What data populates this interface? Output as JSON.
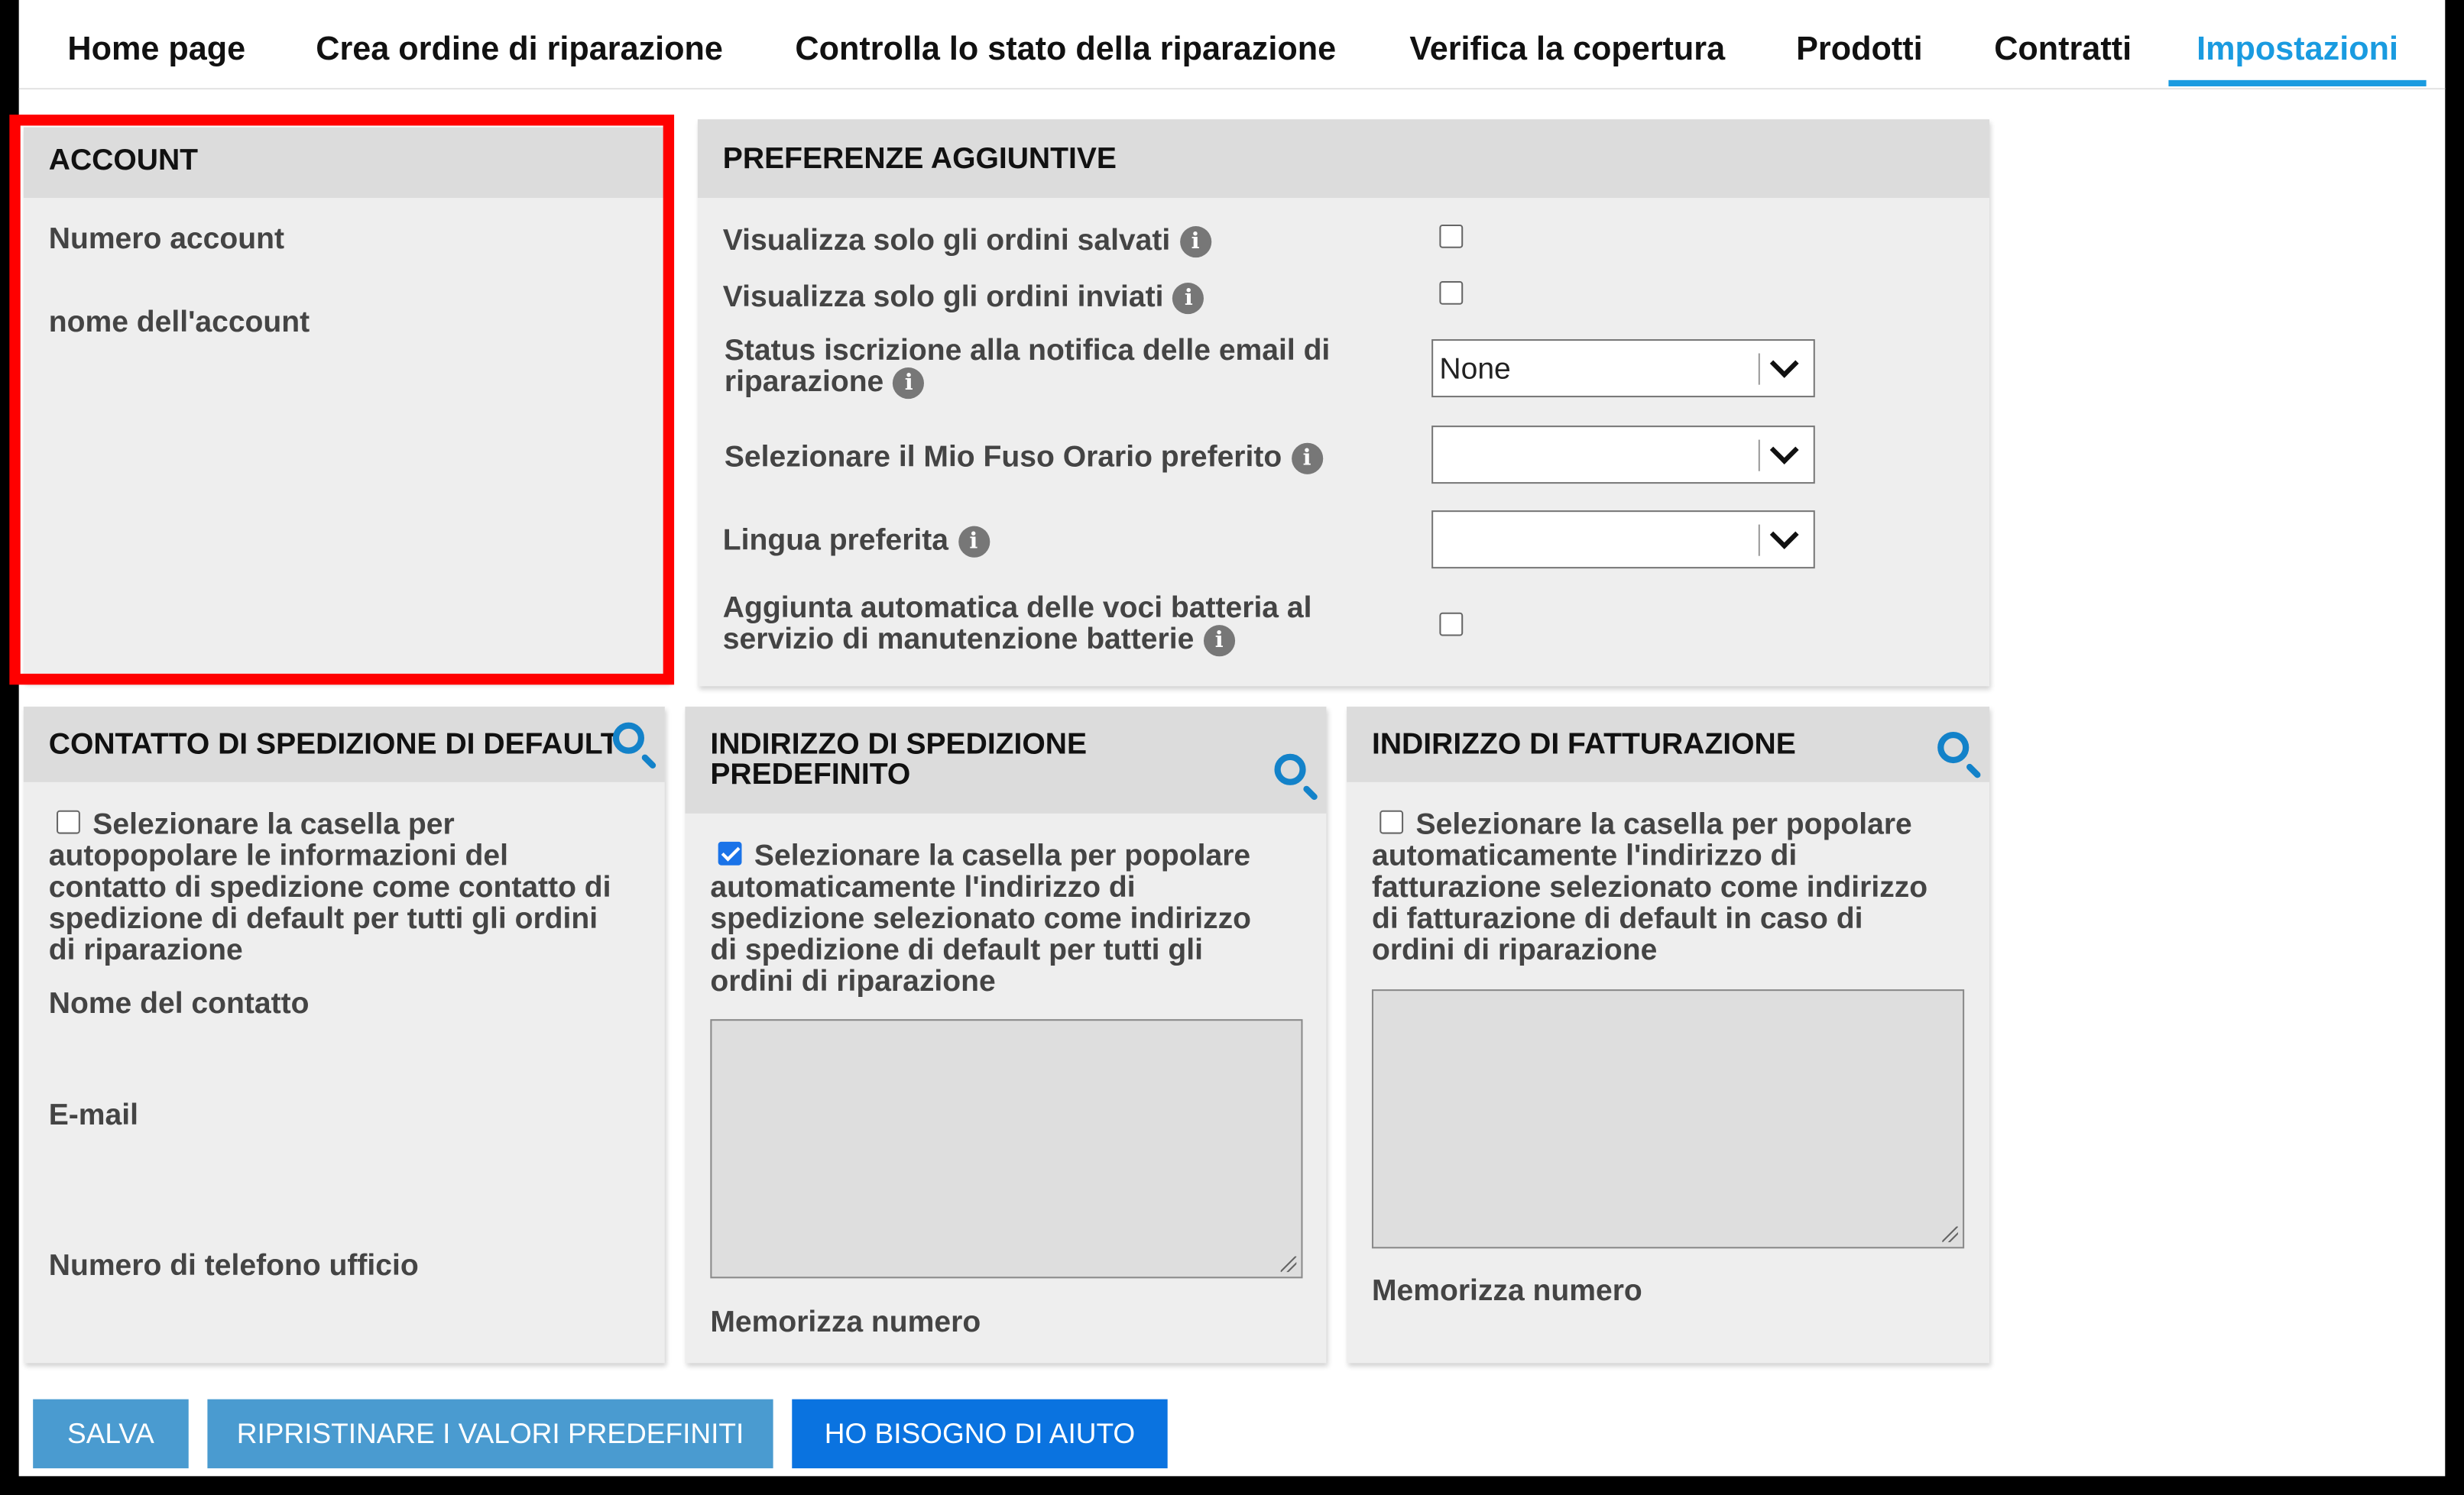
{
  "nav": {
    "tabs": [
      {
        "label": "Home page"
      },
      {
        "label": "Crea ordine di riparazione"
      },
      {
        "label": "Controlla lo stato della riparazione"
      },
      {
        "label": "Verifica la copertura"
      },
      {
        "label": "Prodotti"
      },
      {
        "label": "Contratti"
      },
      {
        "label": "Impostazioni",
        "active": true
      }
    ]
  },
  "account": {
    "title": "ACCOUNT",
    "number_label": "Numero account",
    "name_label": "nome dell'account"
  },
  "preferences": {
    "title": "PREFERENZE AGGIUNTIVE",
    "saved_orders_label": "Visualizza solo gli ordini salvati",
    "sent_orders_label": "Visualizza solo gli ordini inviati",
    "email_status_label_1": "Status iscrizione alla notifica delle email di",
    "email_status_label_2": "riparazione",
    "email_status_value": "None",
    "timezone_label": "Selezionare il Mio Fuso Orario preferito",
    "timezone_value": "",
    "language_label": "Lingua preferita",
    "language_value": "",
    "battery_label_1": "Aggiunta automatica delle voci batteria al",
    "battery_label_2": "servizio di manutenzione batterie",
    "saved_orders_checked": false,
    "sent_orders_checked": false,
    "battery_checked": false
  },
  "contact": {
    "title": "CONTATTO DI SPEDIZIONE DI DEFAULT",
    "checkbox_lines": [
      "Selezionare la casella per",
      "autopopolare le informazioni del",
      "contatto di spedizione come contatto di",
      "spedizione di default per tutti gli ordini",
      "di riparazione"
    ],
    "checked": false,
    "name_label": "Nome del contatto",
    "email_label": "E-mail",
    "phone_label": "Numero di telefono ufficio"
  },
  "shipping_address": {
    "title_1": "INDIRIZZO DI SPEDIZIONE",
    "title_2": "PREDEFINITO",
    "checkbox_lines": [
      "Selezionare la casella per popolare",
      "automaticamente l'indirizzo di",
      "spedizione selezionato come indirizzo",
      "di spedizione di default per tutti gli",
      "ordini di riparazione"
    ],
    "checked": true,
    "store_label": "Memorizza numero"
  },
  "billing_address": {
    "title": "INDIRIZZO DI FATTURAZIONE",
    "checkbox_lines": [
      "Selezionare la casella per popolare",
      "automaticamente l'indirizzo di",
      "fatturazione selezionato come indirizzo",
      "di fatturazione di default in caso di",
      "ordini di riparazione"
    ],
    "checked": false,
    "store_label": "Memorizza numero"
  },
  "buttons": {
    "save": "SALVA",
    "reset": "RIPRISTINARE I VALORI PREDEFINITI",
    "help": "HO BISOGNO DI AIUTO"
  },
  "colors": {
    "accent": "#1a9be0",
    "highlight": "#ff0000",
    "button_light": "#4a9bd0",
    "button_dark": "#0a73e0"
  }
}
